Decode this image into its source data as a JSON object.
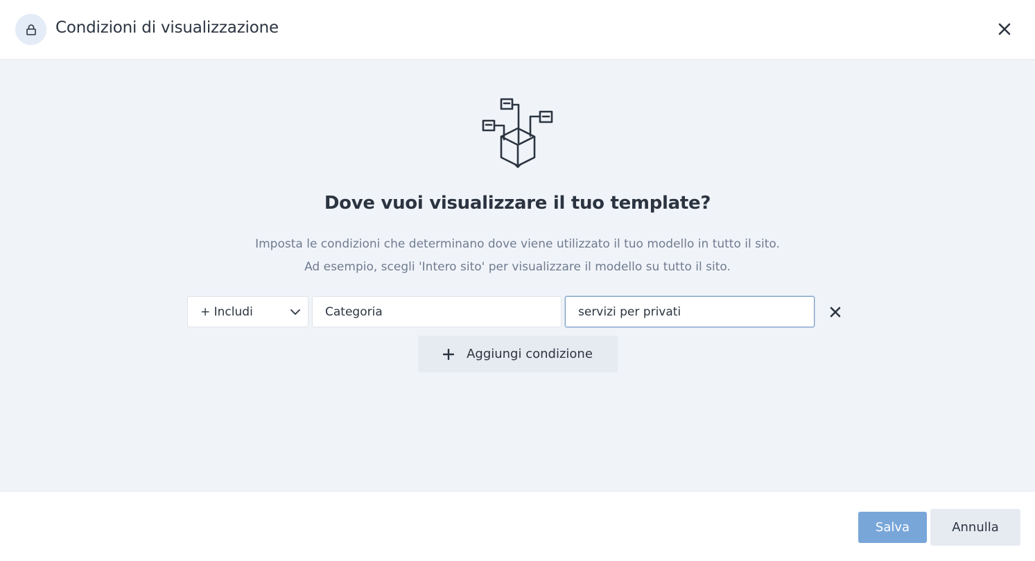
{
  "dialog": {
    "title": "Condizioni di visualizzazione",
    "header_icon": "lock-icon",
    "close_icon": "close-icon"
  },
  "main": {
    "illustration": "sitemap-box-illustration",
    "heading": "Dove vuoi visualizzare il tuo template?",
    "description_line1": "Imposta le condizioni che determinano dove viene utilizzato il tuo modello in tutto il sito.",
    "description_line2": "Ad esempio, scegli 'Intero sito' per visualizzare il modello su tutto il sito.",
    "condition": {
      "mode_label": "+ Includi",
      "type_value": "Categoria",
      "value": "servizi per privati",
      "remove_icon": "close-icon"
    },
    "add_condition_label": "Aggiungi condizione"
  },
  "footer": {
    "save_label": "Salva",
    "cancel_label": "Annulla"
  },
  "colors": {
    "accent": "#78a6d9",
    "text": "#2b3440",
    "muted_text": "#6f7b8f",
    "body_background": "#f0f4f9"
  }
}
